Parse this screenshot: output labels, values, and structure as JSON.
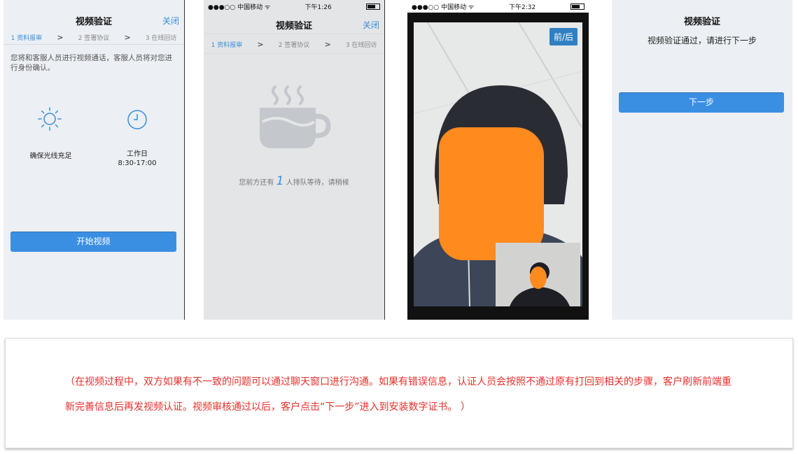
{
  "screen1": {
    "title": "视频验证",
    "close": "关闭",
    "steps": [
      "1 资料报审",
      "2 签署协议",
      "3 在线回访"
    ],
    "chevron": ">",
    "intro": "您将和客服人员进行视频通话，客服人员将对您进行身份确认。",
    "tip_light": "确保光线充足",
    "tip_hours_label": "工作日",
    "tip_hours_time": "8:30-17:00",
    "start_button": "开始视频"
  },
  "screen2": {
    "carrier": "●●●○○ 中国移动 ᯤ",
    "time": "下午1:26",
    "title": "视频验证",
    "close": "关闭",
    "steps": [
      "1 资料报审",
      "2 签署协议",
      "3 在线回访"
    ],
    "chevron": ">",
    "queue_prefix": "您前方还有",
    "queue_count": "1",
    "queue_suffix": "人排队等待，请稍候"
  },
  "screen3": {
    "carrier": "●●●○○ 中国移动 ᯤ",
    "time": "下午2:32",
    "switch_camera": "前/后"
  },
  "screen4": {
    "title": "视频验证",
    "message": "视频验证通过，请进行下一步",
    "next_button": "下一步"
  },
  "caption": {
    "text": "（在视频过程中，双方如果有不一致的问题可以通过聊天窗口进行沟通。如果有错误信息，认证人员会按照不通过原有打回到相关的步骤，客户刷新前端重新完善信息后再发视频认证。视频审核通过以后，客户点击“下一步”进入到安装数字证书。 ）"
  },
  "colors": {
    "accent": "#3b8fe3",
    "caption_red": "#e8302c",
    "face_mask": "#ff8a1e"
  },
  "icons": [
    "sun-icon",
    "clock-icon",
    "coffee-cup-icon"
  ]
}
